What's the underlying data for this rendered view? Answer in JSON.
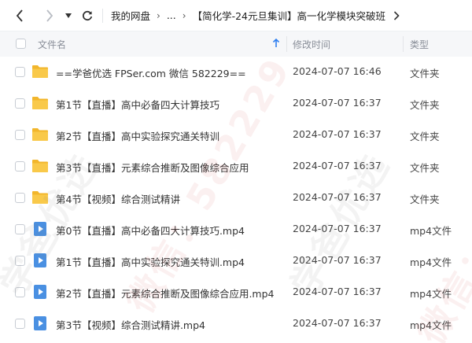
{
  "nav": {
    "breadcrumb_root": "我的网盘",
    "breadcrumb_ellipsis": "...",
    "breadcrumb_current": "【简化学-24元旦集训】高一化学模块突破班"
  },
  "table": {
    "headers": {
      "name": "文件名",
      "modified": "修改时间",
      "type": "类型"
    },
    "sort": "name ascending",
    "rows": [
      {
        "name": "==学爸优选 FPSer.com 微信 582229==",
        "modified": "2024-07-07 16:46",
        "type": "文件夹",
        "icon": "folder-icon"
      },
      {
        "name": "第1节【直播】高中必备四大计算技巧",
        "modified": "2024-07-07 16:37",
        "type": "文件夹",
        "icon": "folder-icon"
      },
      {
        "name": "第2节【直播】高中实验探究通关特训",
        "modified": "2024-07-07 16:37",
        "type": "文件夹",
        "icon": "folder-icon"
      },
      {
        "name": "第3节【直播】元素综合推断及图像综合应用",
        "modified": "2024-07-07 16:37",
        "type": "文件夹",
        "icon": "folder-icon"
      },
      {
        "name": "第4节【视频】综合测试精讲",
        "modified": "2024-07-07 16:37",
        "type": "文件夹",
        "icon": "folder-icon"
      },
      {
        "name": "第0节【直播】高中必备四大计算技巧.mp4",
        "modified": "2024-07-07 16:37",
        "type": "mp4文件",
        "icon": "video-file-icon"
      },
      {
        "name": "第1节【直播】高中实验探究通关特训.mp4",
        "modified": "2024-07-07 16:37",
        "type": "mp4文件",
        "icon": "video-file-icon"
      },
      {
        "name": "第2节【直播】元素综合推断及图像综合应用.mp4",
        "modified": "2024-07-07 16:37",
        "type": "mp4文件",
        "icon": "video-file-icon"
      },
      {
        "name": "第3节【视频】综合测试精讲.mp4",
        "modified": "2024-07-07 16:37",
        "type": "mp4文件",
        "icon": "video-file-icon"
      }
    ]
  },
  "watermark": {
    "text_a": "学爸优选",
    "text_b": "微信：582229"
  },
  "colors": {
    "folder": "#f9c94a",
    "folder_dark": "#f2b62c",
    "video": "#4a90e2",
    "sort_arrow": "#2f7ff0",
    "header_bg": "#f6f7f9"
  }
}
